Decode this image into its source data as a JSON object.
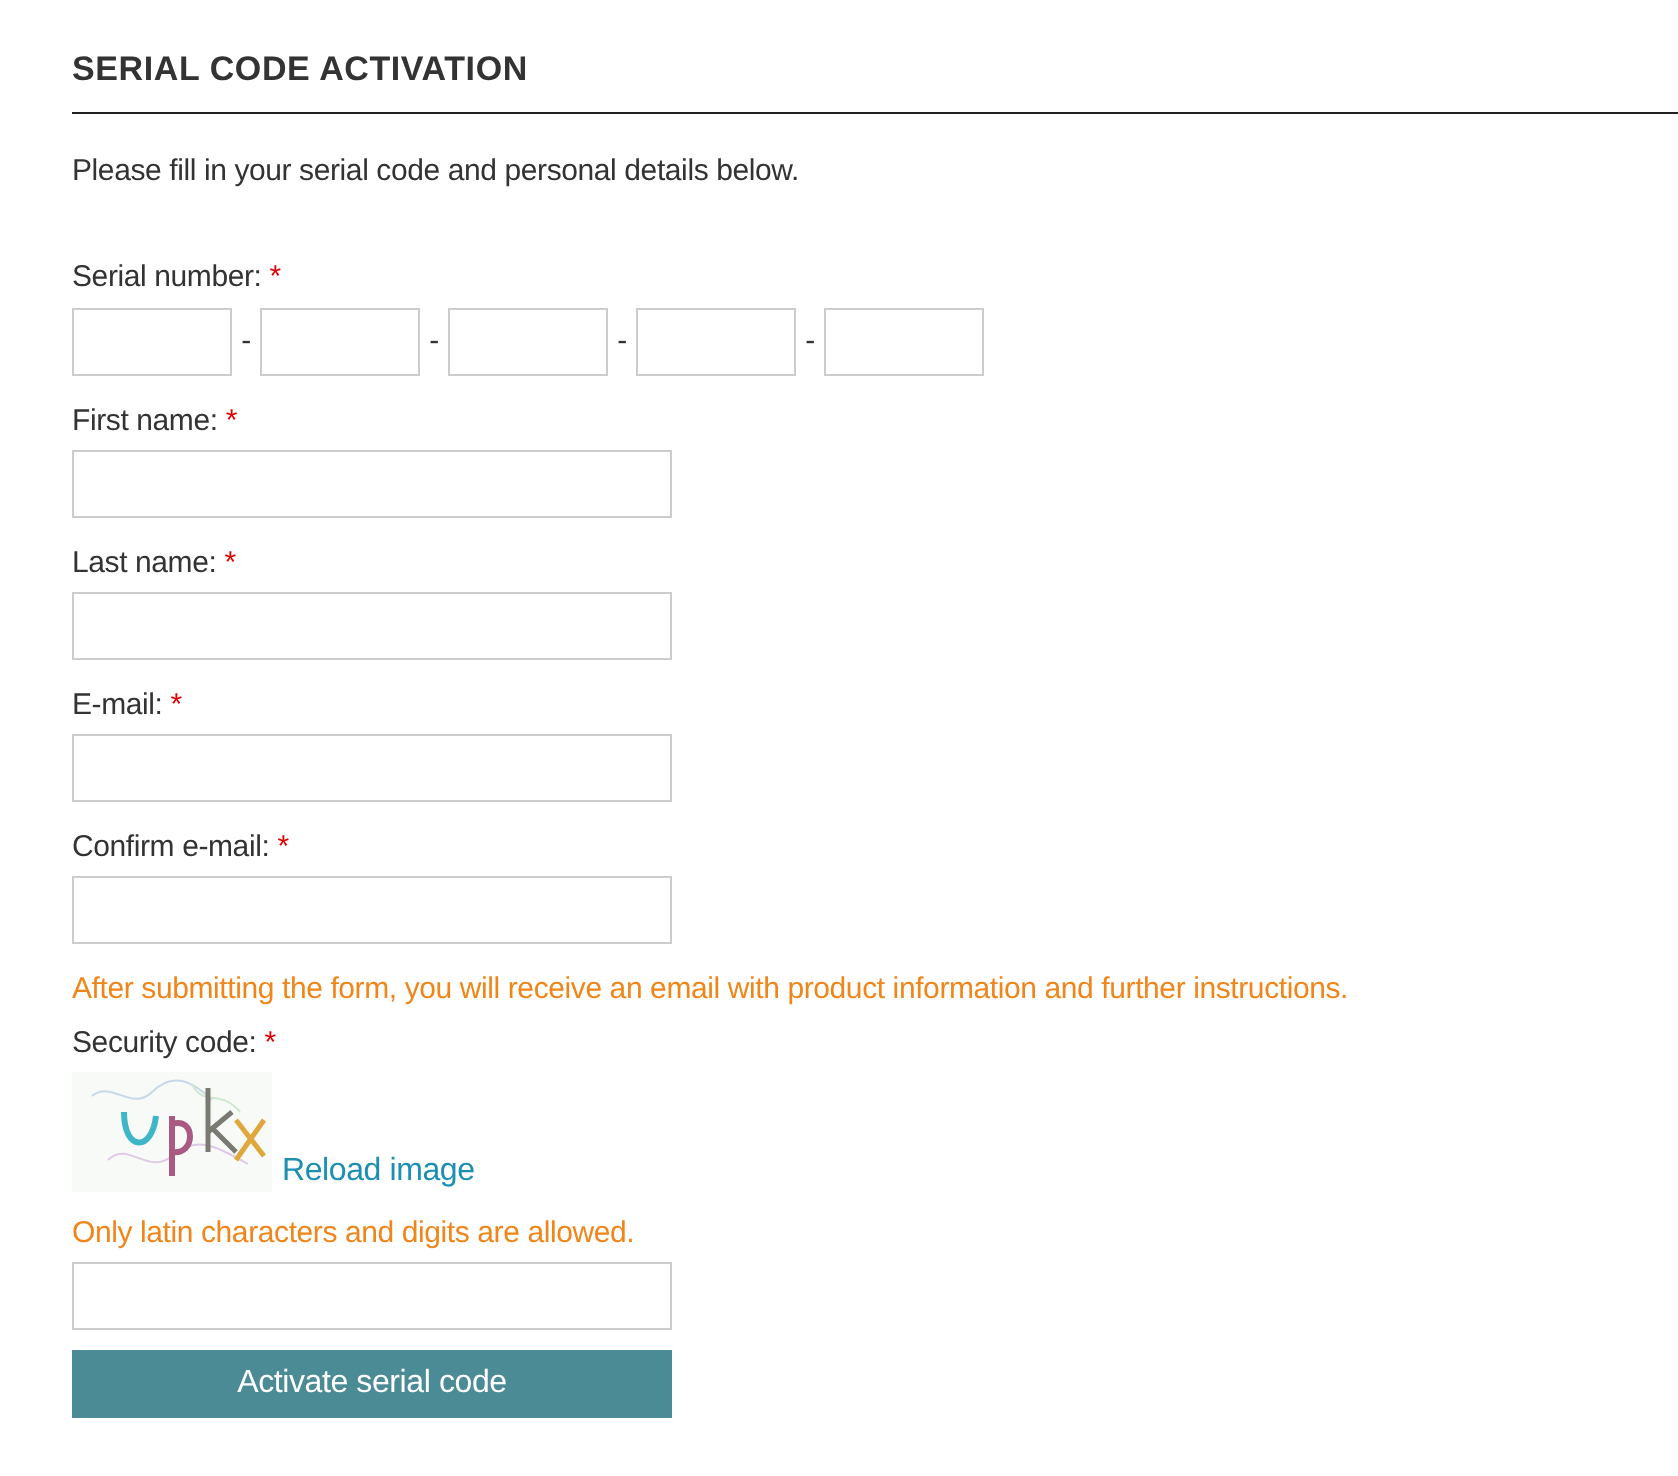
{
  "title": "SERIAL CODE ACTIVATION",
  "intro": "Please fill in your serial code and personal details below.",
  "serial_number": {
    "label": "Serial number:",
    "required_mark": "*",
    "separators": [
      "-",
      "-",
      "-",
      "-"
    ]
  },
  "fields": [
    {
      "label": "First name:",
      "required_mark": "*"
    },
    {
      "label": "Last name:",
      "required_mark": "*"
    },
    {
      "label": "E-mail:",
      "required_mark": "*"
    },
    {
      "label": "Confirm e-mail:",
      "required_mark": "*"
    }
  ],
  "notice": "After submitting the form, you will receive an email with product information and further instructions.",
  "security_code": {
    "label": "Security code:",
    "required_mark": "*",
    "reload_link": "Reload image",
    "hint": "Only latin characters and digits are allowed."
  },
  "submit_button": "Activate serial code"
}
